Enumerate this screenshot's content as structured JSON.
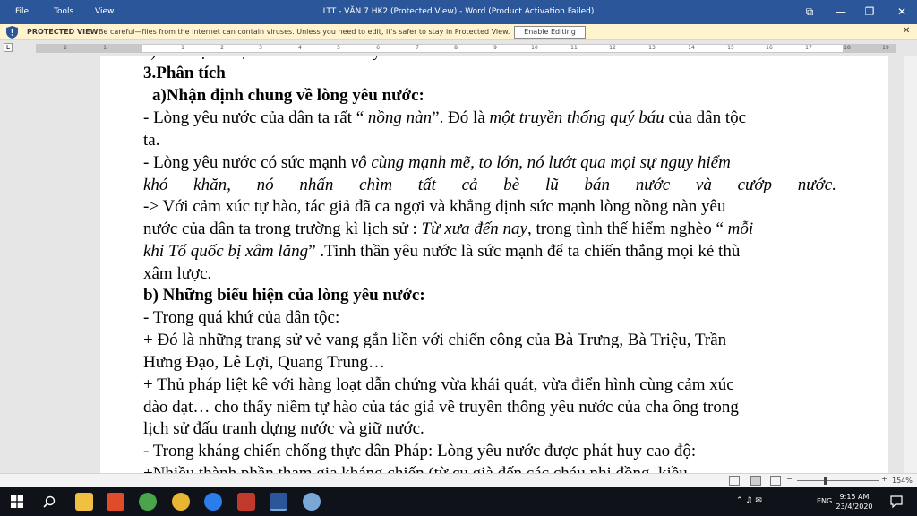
{
  "titlebar": {
    "menu": [
      "File",
      "Tools",
      "View"
    ],
    "title": "LTT - VĂN 7 HK2 (Protected View) - Word (Product Activation Failed)",
    "restore_glyph": "⧉",
    "minimize_glyph": "—",
    "maximize_glyph": "❐",
    "close_glyph": "✕"
  },
  "protected_view": {
    "label": "PROTECTED VIEW",
    "message": "Be careful—files from the Internet can contain viruses. Unless you need to edit, it's safer to stay in Protected View.",
    "button": "Enable Editing",
    "close": "✕"
  },
  "ruler": {
    "corner": "L",
    "numbers": [
      "2",
      "1",
      "1",
      "2",
      "3",
      "4",
      "5",
      "6",
      "7",
      "8",
      "9",
      "10",
      "11",
      "12",
      "13",
      "14",
      "15",
      "16",
      "17",
      "18",
      "19"
    ]
  },
  "document": {
    "top_cut": "c) Xác định luận điểm:  Tinh thần yêu nước của nhân dân ta",
    "h3": "3.Phân tích",
    "ha": "a)Nhận định chung về lòng yêu nước:",
    "p1": {
      "a": "- Lòng yêu nước của dân ta rất “ ",
      "b": "nồng nàn",
      "c": "”. Đó là ",
      "d": "một truyền thống quý báu",
      "e": " của dân tộc"
    },
    "p1b": "ta.",
    "p2": {
      "a": "- Lòng yêu nước có sức mạnh ",
      "b": "vô cùng mạnh mẽ, to lớn, nó lướt qua mọi sự nguy hiểm"
    },
    "p2b": "khó khăn, nó nhấn chìm tất cả bè lũ bán nước và cướp nước.",
    "p3": "-> Với cảm xúc tự hào, tác giả đã ca ngợi và khẳng định sức mạnh lòng nồng nàn yêu",
    "p3b": {
      "a": "nước của dân ta trong trường kì lịch sử : ",
      "b": "Từ xưa đến nay",
      "c": ", trong tình thế hiểm nghèo “ ",
      "d": "mỗi"
    },
    "p3c": {
      "a": "khi Tổ quốc bị xâm lăng",
      "b": "” .Tinh thần yêu nước là sức mạnh để ta chiến thắng mọi kẻ thù"
    },
    "p3d": "xâm lược.",
    "hb": "b) Những biểu hiện của lòng yêu nước:",
    "p4": "- Trong quá khứ của dân tộc:",
    "p5": "+ Đó là những trang sử vẻ vang gắn liền với chiến công của Bà Trưng, Bà Triệu, Trần",
    "p5b": "Hưng Đạo, Lê Lợi, Quang Trung…",
    "p6": "+ Thủ pháp liệt kê với hàng loạt dẫn chứng vừa khái quát, vừa điển hình cùng cảm xúc",
    "p6b": "dào dạt… cho thấy niềm tự hào của tác giả về truyền thống yêu nước của cha ông trong",
    "p6c": "lịch sử đấu tranh dựng nước và giữ nước.",
    "p7": "- Trong kháng chiến chống thực dân Pháp: Lòng yêu nước được phát huy cao độ:",
    "bottom_cut": "+Nhiều thành phần tham gia kháng chiến (từ cụ già đến các cháu nhi đồng, kiều"
  },
  "statusbar": {
    "zoom_minus": "−",
    "zoom_plus": "+",
    "zoom": "154%"
  },
  "taskbar": {
    "time": "9:15 AM",
    "date": "23/4/2020",
    "lang": "ENG",
    "tray_glyphs": "⌃ ♫ ✉",
    "icon_colors": [
      "#f0c040",
      "#e04b2a",
      "#49a54a",
      "#2b7de9",
      "#3a7bd5",
      "#c0392b",
      "#2b579a",
      "#7aa7d6"
    ]
  },
  "colors": {
    "title_blue": "#2b579a",
    "pv_yellow": "#fff4ce"
  }
}
